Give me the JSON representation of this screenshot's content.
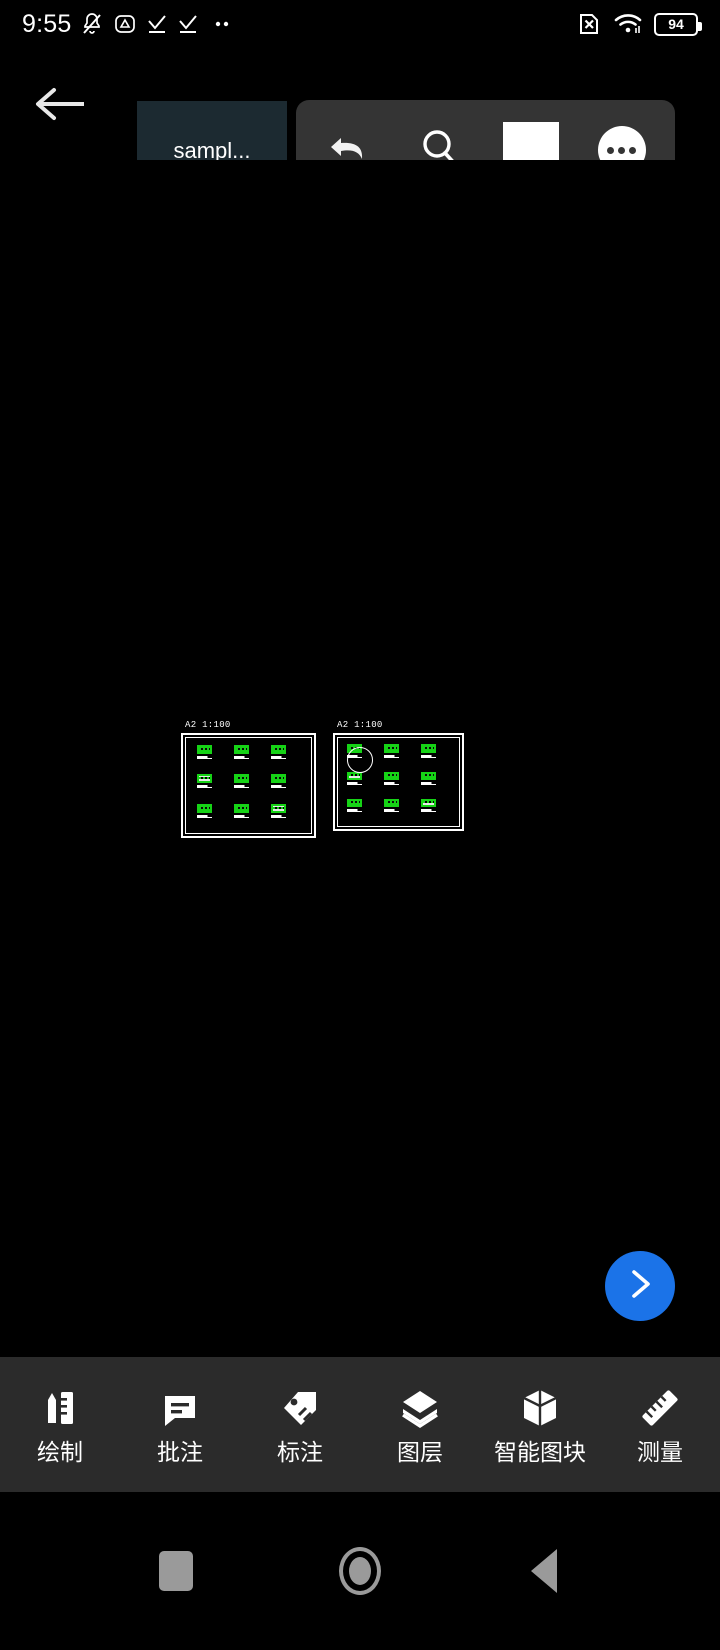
{
  "status_bar": {
    "time": "9:55",
    "battery_level": "94",
    "icons": [
      "bell-mute-icon",
      "triangle-alert-icon",
      "check-underline-icon",
      "check-underline-icon",
      "more-dots-icon"
    ],
    "right_icons": [
      "sim-x-icon",
      "wifi-icon",
      "battery-icon"
    ]
  },
  "topbar": {
    "back_label": "back-arrow",
    "file_tab_title": "sampl...",
    "tools": [
      {
        "name": "undo-button",
        "icon": "undo-arrow-icon"
      },
      {
        "name": "search-button",
        "icon": "search-icon"
      },
      {
        "name": "color-swatch-button",
        "icon": "white-square-icon",
        "color": "#ffffff"
      },
      {
        "name": "more-button",
        "icon": "more-horizontal-icon"
      }
    ]
  },
  "floating_cards": [
    {
      "name": "card-checker",
      "type": "checkerboard-preview"
    },
    {
      "name": "card-lines-bold",
      "type": "line-weight-preview"
    },
    {
      "name": "card-lines-thin",
      "type": "line-weight-preview"
    }
  ],
  "canvas": {
    "sheets": [
      {
        "label": "A2 1:100",
        "name": "cad-sheet-left"
      },
      {
        "label": "A2 1:100",
        "name": "cad-sheet-right"
      }
    ]
  },
  "fab": {
    "name": "next-page-fab",
    "icon": "chevron-right-icon",
    "color": "#1b73e8"
  },
  "bottom_nav": {
    "items": [
      {
        "label": "绘制",
        "icon": "pencil-ruler-icon"
      },
      {
        "label": "批注",
        "icon": "comment-icon"
      },
      {
        "label": "标注",
        "icon": "tag-icon"
      },
      {
        "label": "图层",
        "icon": "layers-icon"
      },
      {
        "label": "智能图块",
        "icon": "cube-icon"
      },
      {
        "label": "测量",
        "icon": "ruler-icon"
      }
    ]
  },
  "android_nav": {
    "buttons": [
      {
        "name": "recents-button",
        "icon": "square-icon"
      },
      {
        "name": "home-button",
        "icon": "circle-icon"
      },
      {
        "name": "back-button",
        "icon": "triangle-left-icon"
      }
    ]
  }
}
